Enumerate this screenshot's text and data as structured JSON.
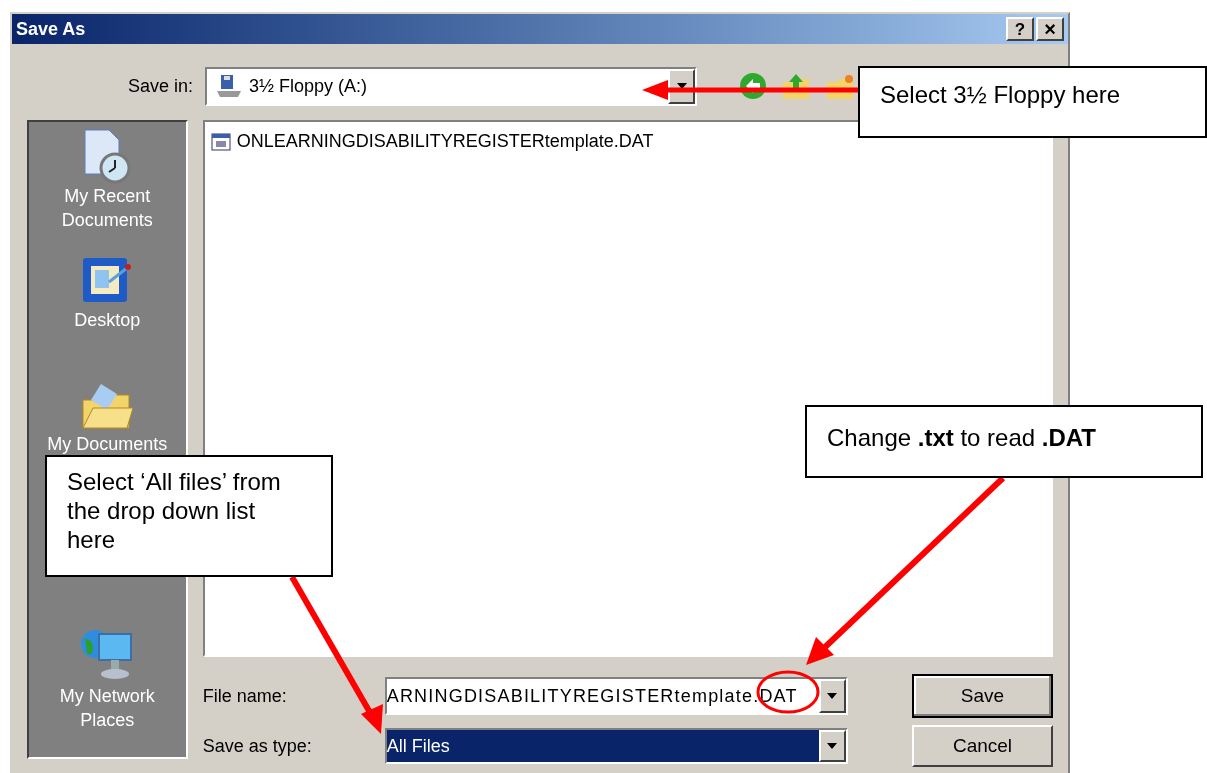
{
  "window": {
    "title": "Save As",
    "help_button": "?",
    "close_button": "×"
  },
  "save_in": {
    "label": "Save in:",
    "value": "3½ Floppy (A:)"
  },
  "places": [
    {
      "label": "My Recent Documents"
    },
    {
      "label": "Desktop"
    },
    {
      "label": "My Documents"
    },
    {
      "label": "My Network Places"
    }
  ],
  "files": [
    {
      "name": "ONLEARNINGDISABILITYREGISTERtemplate.DAT"
    }
  ],
  "file_name": {
    "label": "File name:",
    "value": "ARNINGDISABILITYREGISTERtemplate.DAT"
  },
  "save_as_type": {
    "label": "Save as type:",
    "value": "All Files",
    "selected": true
  },
  "buttons": [
    "Save",
    "Cancel"
  ],
  "callouts": [
    {
      "text": "Select 3½ Floppy here"
    },
    {
      "text": "Change **.txt** to read **.DAT**"
    },
    {
      "text": "Select ‘All files’ from the drop down list here"
    }
  ]
}
